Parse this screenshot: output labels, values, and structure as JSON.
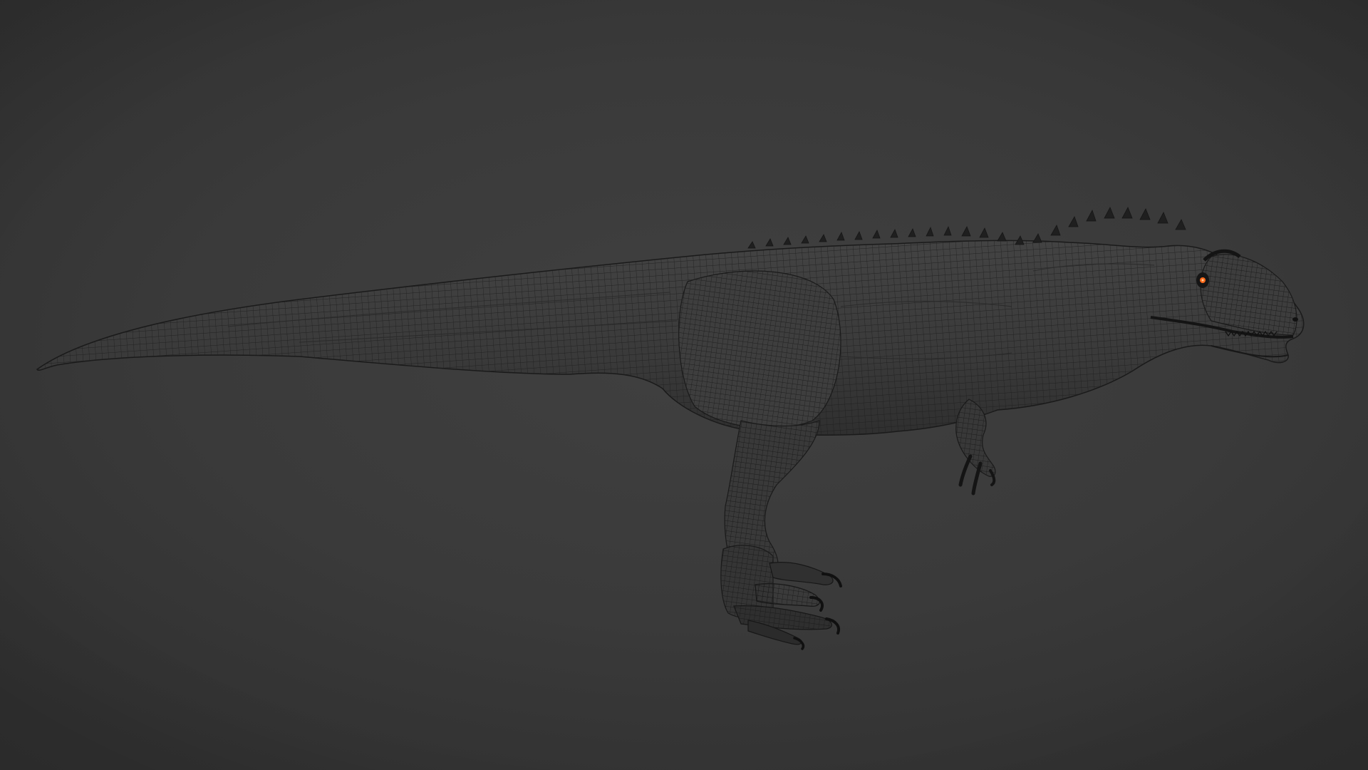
{
  "viewport": {
    "background_color": "#3a3a3a",
    "mesh_fill_color": "#3b3b3b",
    "wire_color": "#1c1c1c",
    "eye_color": "#ff6a1a"
  },
  "model": {
    "icon": "dinosaur-wireframe-mesh"
  }
}
